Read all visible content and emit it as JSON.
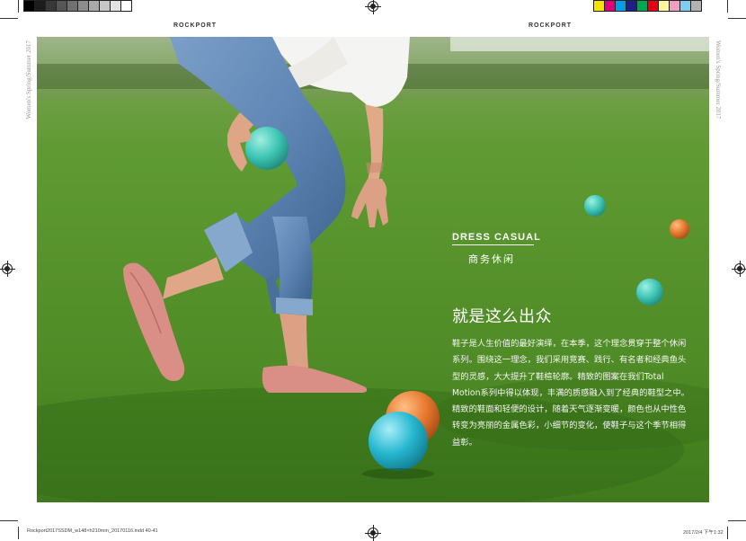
{
  "page": {
    "brand_left": "ROCKPORT",
    "brand_right": "ROCKPORT",
    "side_text_left": "Women's Spring/Summer 2017",
    "side_text_right": "Women's Spring/Summer 2017",
    "slug_left": "Rockport2017SSDM_w148×h210mm_20170116.indd 40-41",
    "slug_right": "2017/2/4  下午1:32"
  },
  "feature": {
    "section_title": "DRESS CASUAL",
    "section_subtitle": "商务休闲",
    "headline": "就是这么出众",
    "body": "鞋子是人生价值的最好演绎，在本季，这个理念贯穿于整个休闲系列。围绕这一理念，我们采用竞赛、践行、有名者和经典鱼头型的灵感，大大提升了鞋楦轮廓。精致的图案在我们Total Motion系列中得以体现，丰满的质感融入到了经典的鞋型之中。精致的鞋面和轻便的设计，随着天气逐渐变暖，颜色也从中性色转变为亮丽的金属色彩，小细节的变化，使鞋子与这个季节相得益彰。"
  },
  "print_marks": {
    "gray_swatches": [
      "#000000",
      "#1c1c1c",
      "#383838",
      "#555555",
      "#717171",
      "#8d8d8d",
      "#aaaaaa",
      "#c6c6c6",
      "#e2e2e2",
      "#ffffff"
    ],
    "color_swatches": [
      "#f5e400",
      "#e2007a",
      "#00a0e9",
      "#1d2088",
      "#00a650",
      "#e60012",
      "#fff799",
      "#f19ec2",
      "#7ecef4",
      "#b3b3b3"
    ]
  },
  "colors": {
    "ball_teal": "#3fc6b5",
    "ball_orange": "#e8782e",
    "ball_cyan": "#26b7cf",
    "shoe_pink": "#d98f85",
    "denim": "#5f86b5"
  }
}
